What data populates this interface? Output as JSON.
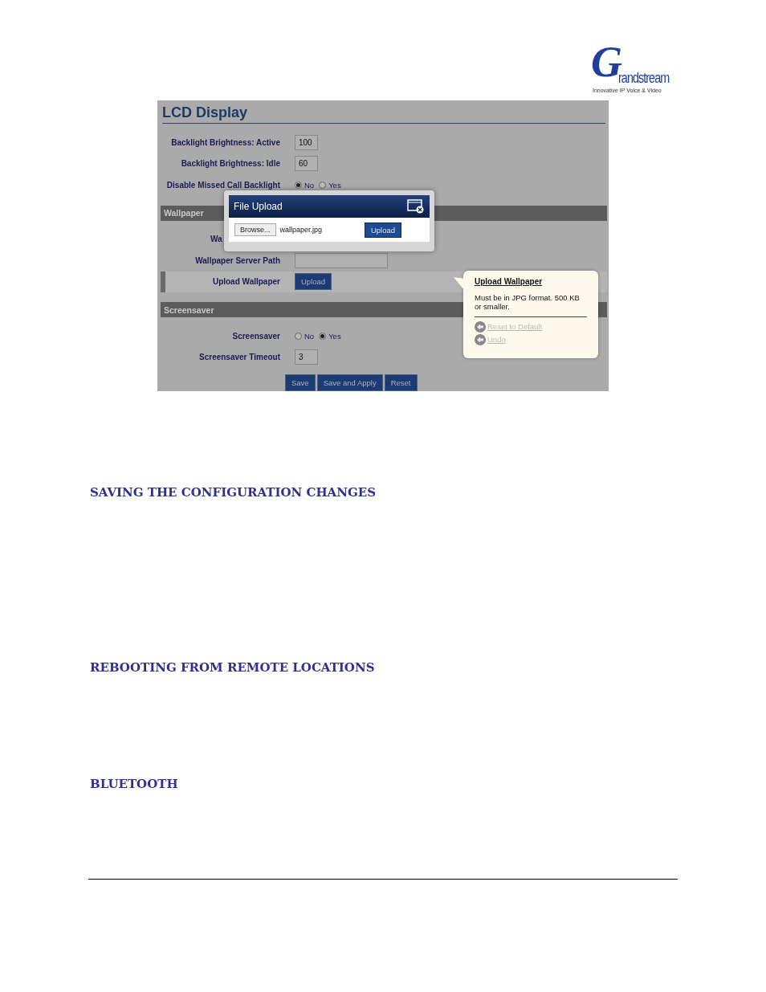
{
  "logo": {
    "initial": "G",
    "rest": "randstream",
    "tagline": "Innovative IP Voice & Video"
  },
  "screenshot": {
    "title": "LCD Display",
    "rows": [
      {
        "kind": "input",
        "label": "Backlight Brightness: Active",
        "value": "100"
      },
      {
        "kind": "input",
        "label": "Backlight Brightness: Idle",
        "value": "60"
      },
      {
        "kind": "radio",
        "label": "Disable Missed Call Backlight",
        "options": [
          {
            "label": "No",
            "selected": true
          },
          {
            "label": "Yes",
            "selected": false
          }
        ]
      },
      {
        "kind": "section",
        "label": "Wallpaper"
      },
      {
        "kind": "label",
        "label": "Wa"
      },
      {
        "kind": "input",
        "label": "Wallpaper Server Path",
        "value": ""
      },
      {
        "kind": "button",
        "label": "Upload Wallpaper",
        "button": "Upload",
        "highlighted": true
      },
      {
        "kind": "section",
        "label": "Screensaver"
      },
      {
        "kind": "radio",
        "label": "Screensaver",
        "options": [
          {
            "label": "No",
            "selected": false
          },
          {
            "label": "Yes",
            "selected": true
          }
        ]
      },
      {
        "kind": "input",
        "label": "Screensaver Timeout",
        "value": "3"
      }
    ],
    "buttons": [
      "Save",
      "Save and Apply",
      "Reset"
    ],
    "dialog": {
      "title": "File Upload",
      "browse": "Browse...",
      "file": "wallpaper.jpg",
      "upload": "Upload"
    },
    "tooltip": {
      "title": "Upload Wallpaper",
      "text": "Must be in JPG format. 500 KB or smaller.",
      "links": [
        "Reset to Default",
        "Undo"
      ]
    }
  },
  "headings": [
    "SAVING THE CONFIGURATION CHANGES",
    "REBOOTING FROM REMOTE LOCATIONS",
    "BLUETOOTH"
  ]
}
